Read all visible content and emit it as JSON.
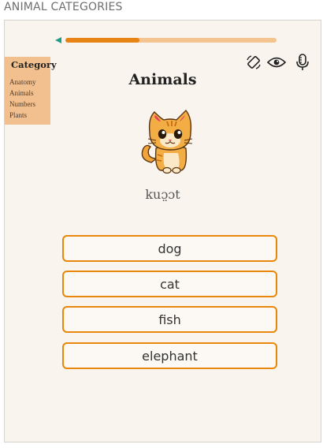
{
  "app": {
    "title": "ANIMAL CATEGORIES"
  },
  "progress": {
    "value": 0.35
  },
  "toolbar": {
    "icons": [
      "rotate-icon",
      "eye-icon",
      "microphone-icon"
    ]
  },
  "category": {
    "title": "Category",
    "items": [
      "Anatomy",
      "Animals",
      "Numbers",
      "Plants"
    ]
  },
  "card": {
    "word": "Animals",
    "illustration": "cat-illustration",
    "pronunciation": "kuɔ̤ɔt"
  },
  "options": [
    "dog",
    "cat",
    "fish",
    "elephant"
  ],
  "colors": {
    "accent": "#e78214",
    "progress_track": "#f3c48f",
    "category_panel": "#f2c08e",
    "card_bg": "#f9f4ee",
    "back_arrow": "#1e9e88"
  }
}
